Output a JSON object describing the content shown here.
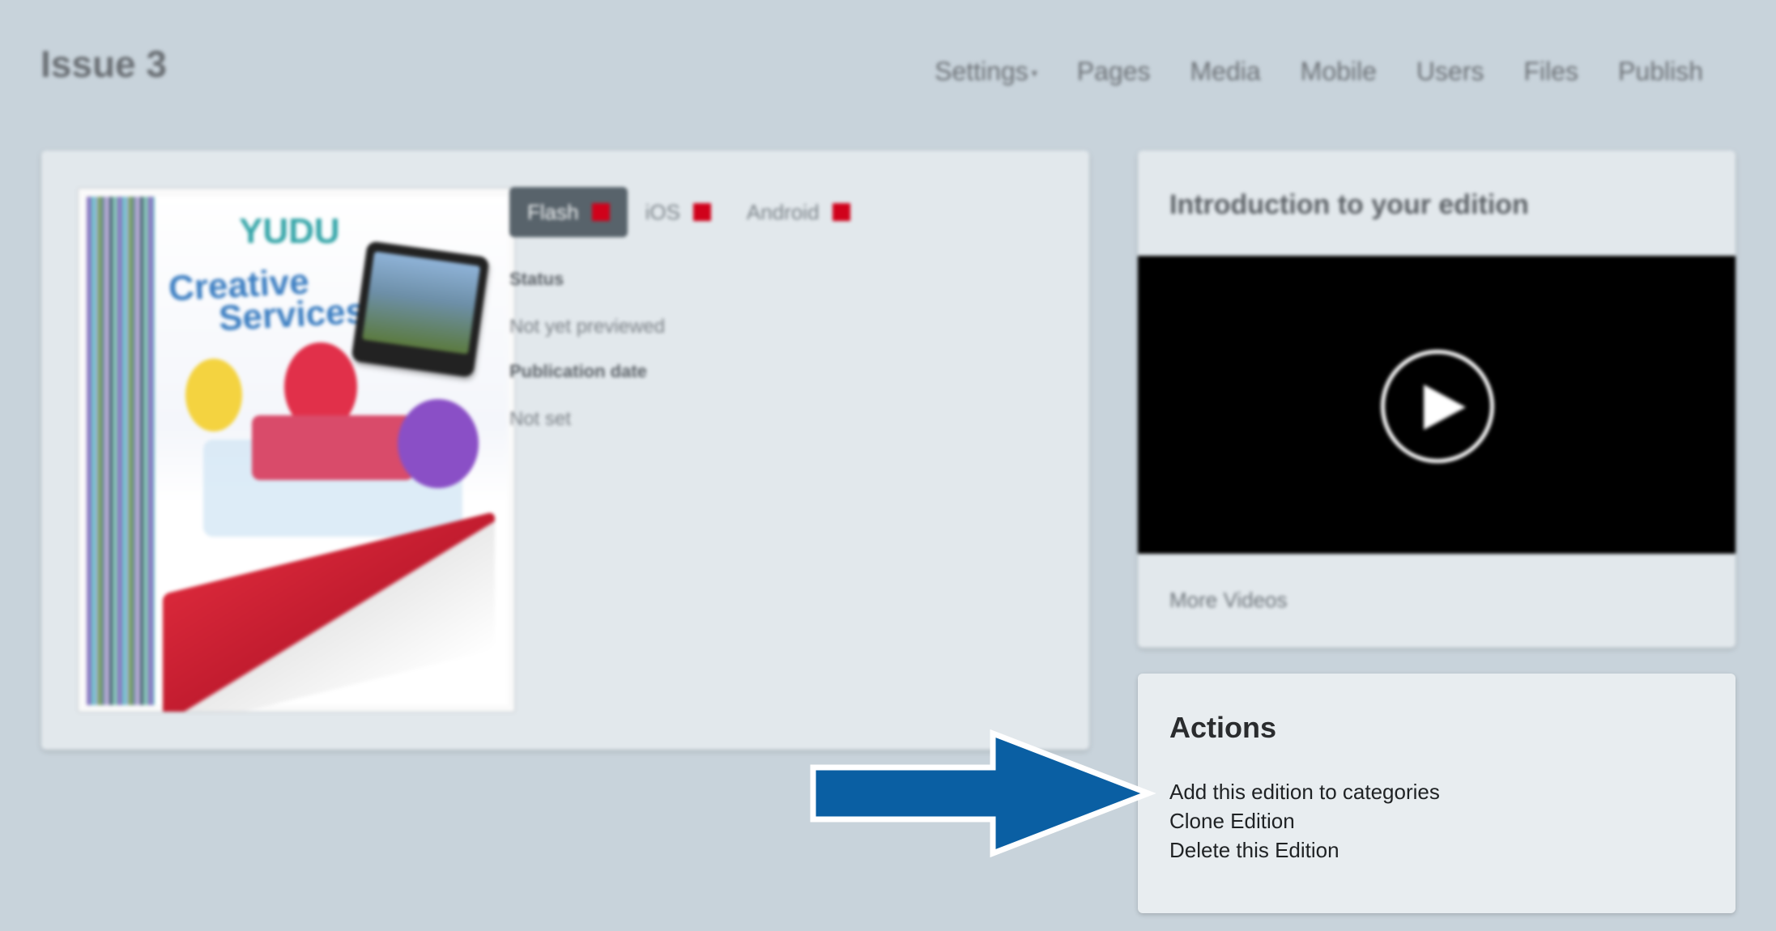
{
  "header": {
    "title": "Issue 3",
    "nav": [
      {
        "label": "Settings",
        "has_dropdown": true
      },
      {
        "label": "Pages"
      },
      {
        "label": "Media"
      },
      {
        "label": "Mobile"
      },
      {
        "label": "Users"
      },
      {
        "label": "Files"
      },
      {
        "label": "Publish"
      }
    ]
  },
  "edition": {
    "cover": {
      "logo_text": "YUDU",
      "headline_line1": "Creative",
      "headline_line2": "Services"
    },
    "platform_tabs": [
      {
        "label": "Flash",
        "active": true,
        "status_color": "#d0021b"
      },
      {
        "label": "iOS",
        "active": false,
        "status_color": "#d0021b"
      },
      {
        "label": "Android",
        "active": false,
        "status_color": "#d0021b"
      }
    ],
    "status_label": "Status",
    "status_value": "Not yet previewed",
    "publication_date_label": "Publication date",
    "publication_date_value": "Not set"
  },
  "video_panel": {
    "title": "Introduction to your edition",
    "more_link": "More Videos"
  },
  "actions_panel": {
    "title": "Actions",
    "links": [
      "Add this edition to categories",
      "Clone Edition",
      "Delete this Edition"
    ]
  },
  "colors": {
    "background": "#c8d3db",
    "arrow": "#0a5fa3",
    "status_red": "#d0021b",
    "active_tab": "#58636b"
  },
  "icons": {
    "play": "play-icon",
    "arrow": "right-arrow-icon"
  }
}
